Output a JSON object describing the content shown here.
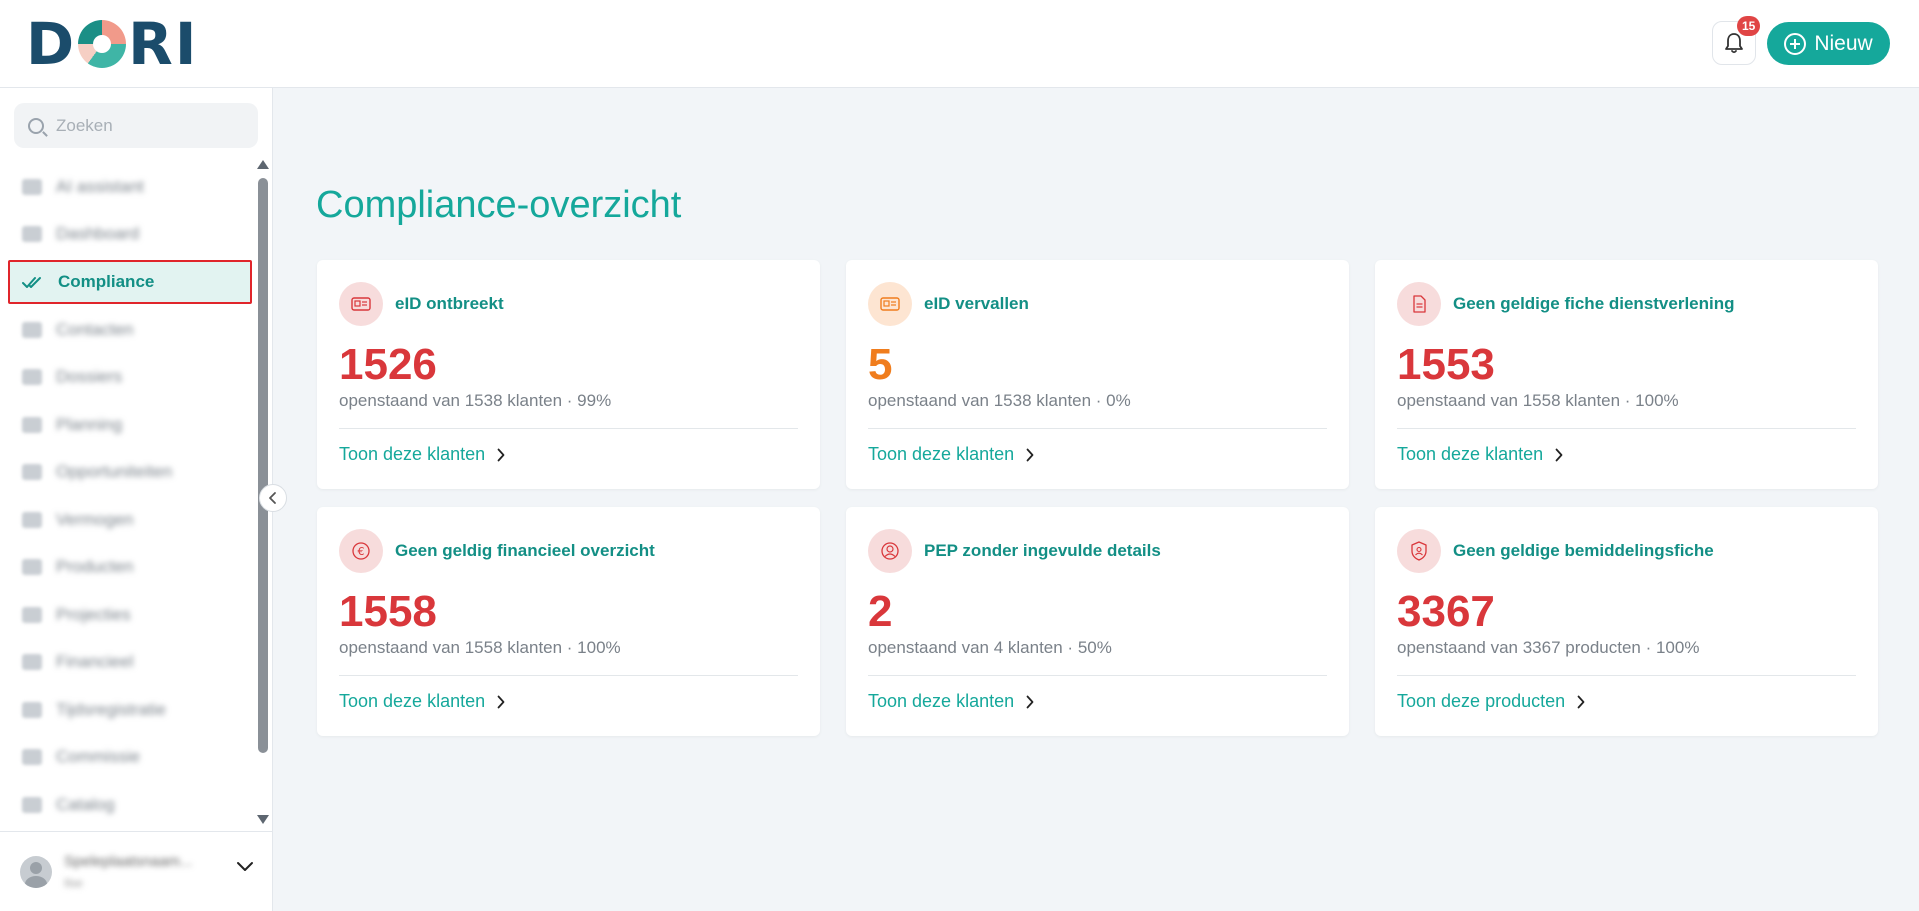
{
  "app": {
    "logo_text": "DORI",
    "notifications_count": "15",
    "new_button_label": "Nieuw"
  },
  "sidebar": {
    "search_placeholder": "Zoeken",
    "items": [
      {
        "label": "AI assistant",
        "icon": "ai-icon",
        "active": false
      },
      {
        "label": "Dashboard",
        "icon": "dashboard-icon",
        "active": false
      },
      {
        "label": "Compliance",
        "icon": "double-check-icon",
        "active": true
      },
      {
        "label": "Contacten",
        "icon": "contacts-icon",
        "active": false
      },
      {
        "label": "Dossiers",
        "icon": "folder-icon",
        "active": false
      },
      {
        "label": "Planning",
        "icon": "calendar-icon",
        "active": false
      },
      {
        "label": "Opportuniteiten",
        "icon": "opportunity-icon",
        "active": false
      },
      {
        "label": "Vermogen",
        "icon": "wealth-icon",
        "active": false
      },
      {
        "label": "Producten",
        "icon": "product-icon",
        "active": false
      },
      {
        "label": "Projecties",
        "icon": "projection-icon",
        "active": false
      },
      {
        "label": "Financieel",
        "icon": "finance-icon",
        "active": false
      },
      {
        "label": "Tijdsregistratie",
        "icon": "time-icon",
        "active": false
      },
      {
        "label": "Commissie",
        "icon": "commission-icon",
        "active": false
      },
      {
        "label": "Catalog",
        "icon": "catalog-icon",
        "active": false
      }
    ],
    "user": {
      "name": "Speleplaatsnaam...",
      "role": "Ilse"
    }
  },
  "main": {
    "title": "Compliance-overzicht",
    "cards": [
      {
        "title": "eID ontbreekt",
        "value": "1526",
        "sub": "openstaand van 1538 klanten · 99%",
        "link": "Toon deze klanten",
        "icon": "id-card-icon",
        "tone": "red"
      },
      {
        "title": "eID vervallen",
        "value": "5",
        "sub": "openstaand van 1538 klanten · 0%",
        "link": "Toon deze klanten",
        "icon": "id-card-icon",
        "tone": "orange"
      },
      {
        "title": "Geen geldige fiche dienstverlening",
        "value": "1553",
        "sub": "openstaand van 1558 klanten · 100%",
        "link": "Toon deze klanten",
        "icon": "document-icon",
        "tone": "red"
      },
      {
        "title": "Geen geldig financieel overzicht",
        "value": "1558",
        "sub": "openstaand van 1558 klanten · 100%",
        "link": "Toon deze klanten",
        "icon": "euro-icon",
        "tone": "red"
      },
      {
        "title": "PEP zonder ingevulde details",
        "value": "2",
        "sub": "openstaand van 4 klanten · 50%",
        "link": "Toon deze klanten",
        "icon": "user-circle-icon",
        "tone": "red"
      },
      {
        "title": "Geen geldige bemiddelingsfiche",
        "value": "3367",
        "sub": "openstaand van 3367 producten · 100%",
        "link": "Toon deze producten",
        "icon": "shield-icon",
        "tone": "red"
      }
    ]
  },
  "colors": {
    "accent": "#15a89b",
    "danger": "#d9373b",
    "warning": "#f07d1d"
  }
}
